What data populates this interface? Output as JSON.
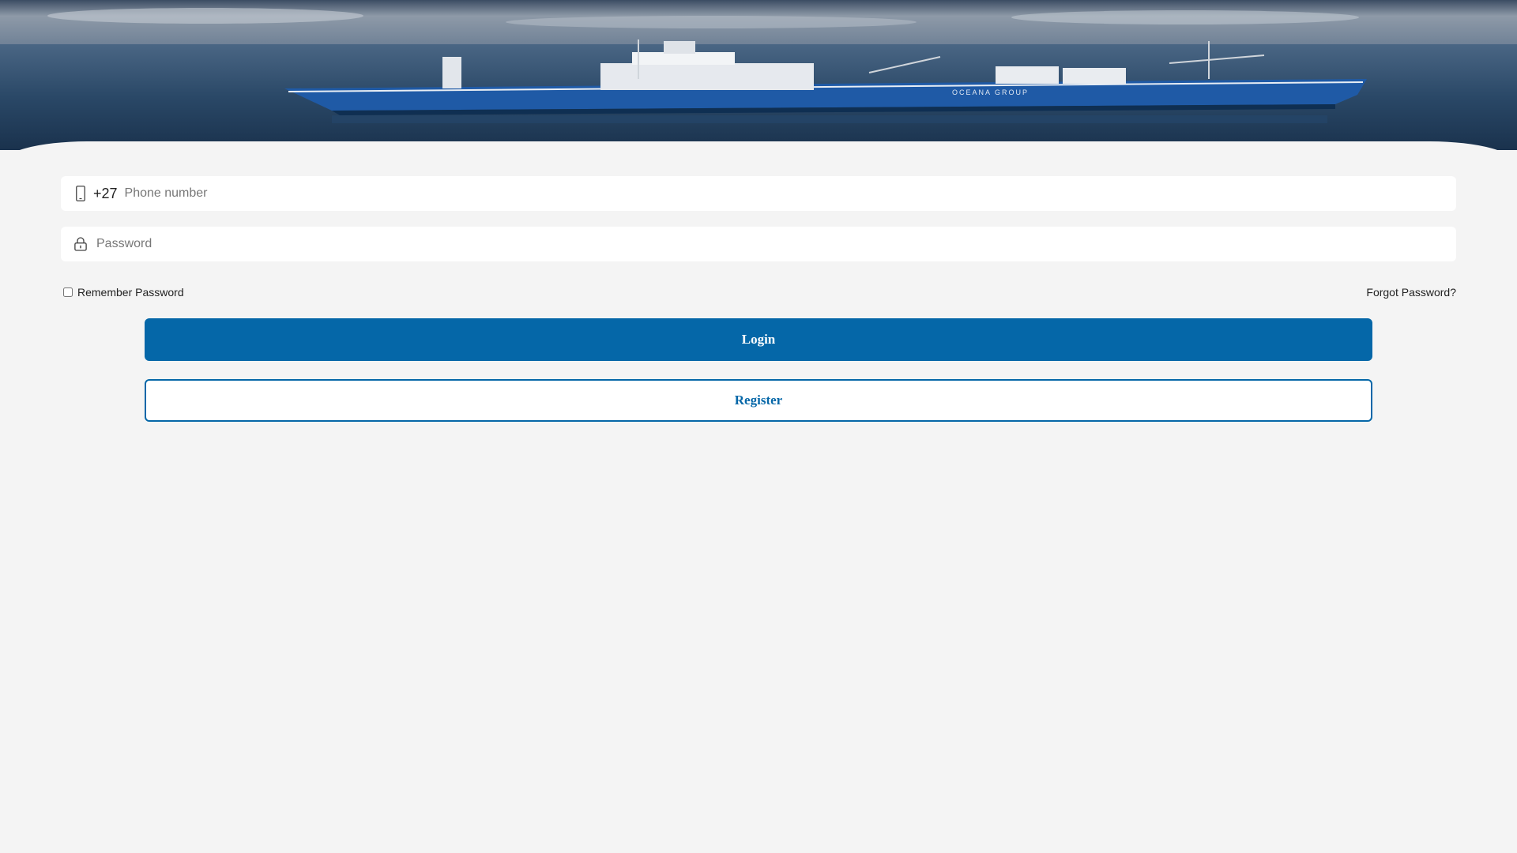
{
  "banner": {
    "image_alt": "Fishing vessel at sea",
    "ship_text": "OCEANA GROUP"
  },
  "form": {
    "phone": {
      "icon": "mobile-phone-icon",
      "country_code": "+27",
      "placeholder": "Phone number",
      "value": ""
    },
    "password": {
      "icon": "lock-icon",
      "placeholder": "Password",
      "value": ""
    },
    "remember_label": "Remember Password",
    "remember_checked": false,
    "forgot_label": "Forgot Password?",
    "login_label": "Login",
    "register_label": "Register"
  },
  "colors": {
    "primary": "#0567a8",
    "background": "#f4f4f4",
    "field_bg": "#ffffff"
  }
}
